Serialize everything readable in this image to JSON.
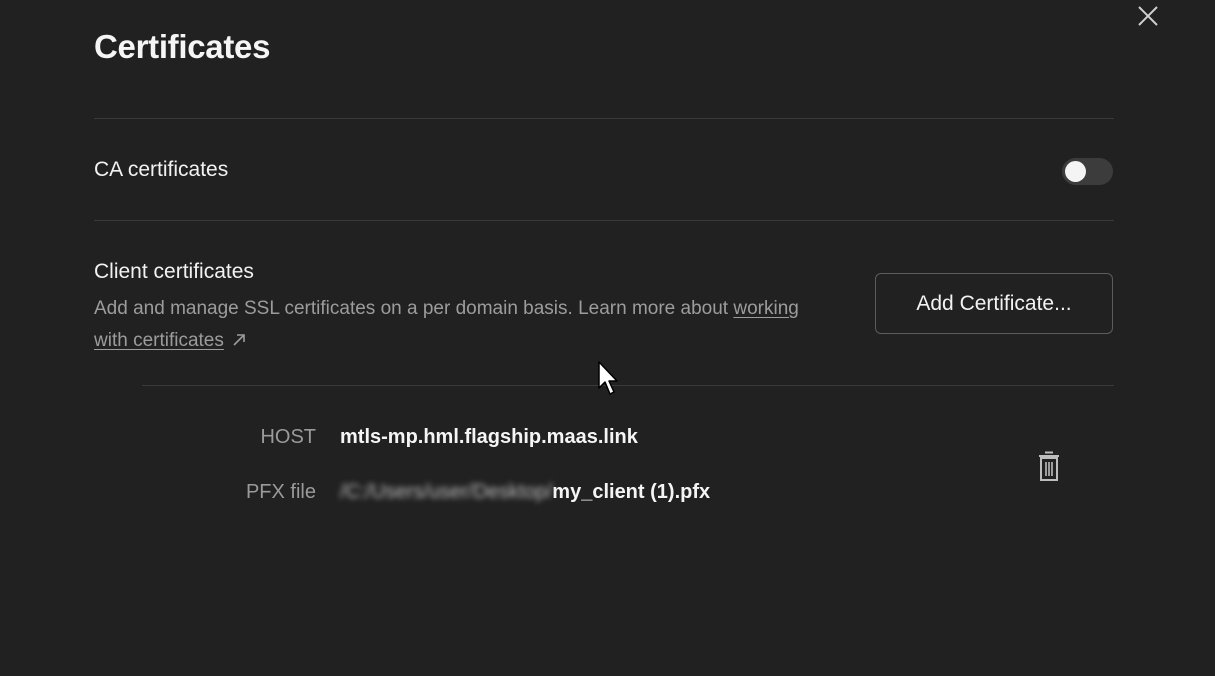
{
  "dialog": {
    "title": "Certificates",
    "close_icon": "close-icon"
  },
  "ca": {
    "label": "CA certificates",
    "enabled": false
  },
  "client": {
    "title": "Client certificates",
    "description_prefix": "Add and manage SSL certificates on a per domain basis. Learn more about ",
    "link_text": "working with certificates",
    "link_icon": "external-link-icon",
    "add_button_label": "Add Certificate..."
  },
  "certificate": {
    "host_label": "HOST",
    "host_value": "mtls-mp.hml.flagship.maas.link",
    "pfx_label": "PFX file",
    "pfx_path_prefix": "/C:/Users/user/Desktop/",
    "pfx_filename": "my_client (1).pfx",
    "delete_icon": "trash-icon"
  },
  "colors": {
    "background": "#212121",
    "divider": "#3a3a3a",
    "muted_text": "#9c9c9c",
    "primary_text": "#f2f2f2"
  }
}
